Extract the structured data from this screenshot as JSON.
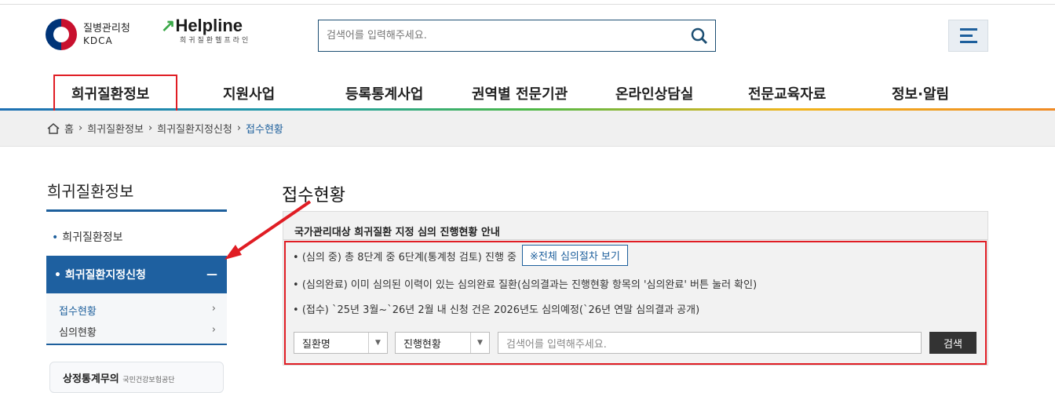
{
  "header": {
    "org_name": "질병관리청",
    "org_abbr": "KDCA",
    "helpline_logo": "Helpline",
    "helpline_sub": "희귀질환헬프라인",
    "search_placeholder": "검색어를 입력해주세요."
  },
  "gnb": [
    "희귀질환정보",
    "지원사업",
    "등록통계사업",
    "권역별 전문기관",
    "온라인상담실",
    "전문교육자료",
    "정보·알림"
  ],
  "breadcrumb": [
    "홈",
    "희귀질환정보",
    "희귀질환지정신청",
    "접수현황"
  ],
  "sidebar": {
    "title": "희귀질환정보",
    "item1": "희귀질환정보",
    "active": "희귀질환지정신청",
    "sub": [
      "접수현황",
      "심의현황"
    ],
    "box_title": "상정통계무의",
    "box_sub": "국민건강보험공단"
  },
  "main": {
    "title": "접수현황",
    "panel_title": "국가관리대상 희귀질환 지정 심의 진행현황 안내",
    "notes": [
      "(심의 중) 총 8단계 중 6단계(통계청 검토) 진행 중",
      "(심의완료) 이미 심의된 이력이 있는 심의완료 질환(심의결과는 진행현황 항목의 '심의완료' 버튼 눌러 확인)",
      "(접수) `25년 3월~`26년 2월 내 신청 건은 2026년도 심의예정(`26년 연말 심의결과 공개)"
    ],
    "process_button": "※전체 심의절차 보기",
    "filter1": "질환명",
    "filter2": "진행현황",
    "keyword_placeholder": "검색어를 입력해주세요.",
    "search_button": "검색"
  },
  "colors": {
    "accent": "#1e60a0",
    "highlight": "#e01d24"
  }
}
